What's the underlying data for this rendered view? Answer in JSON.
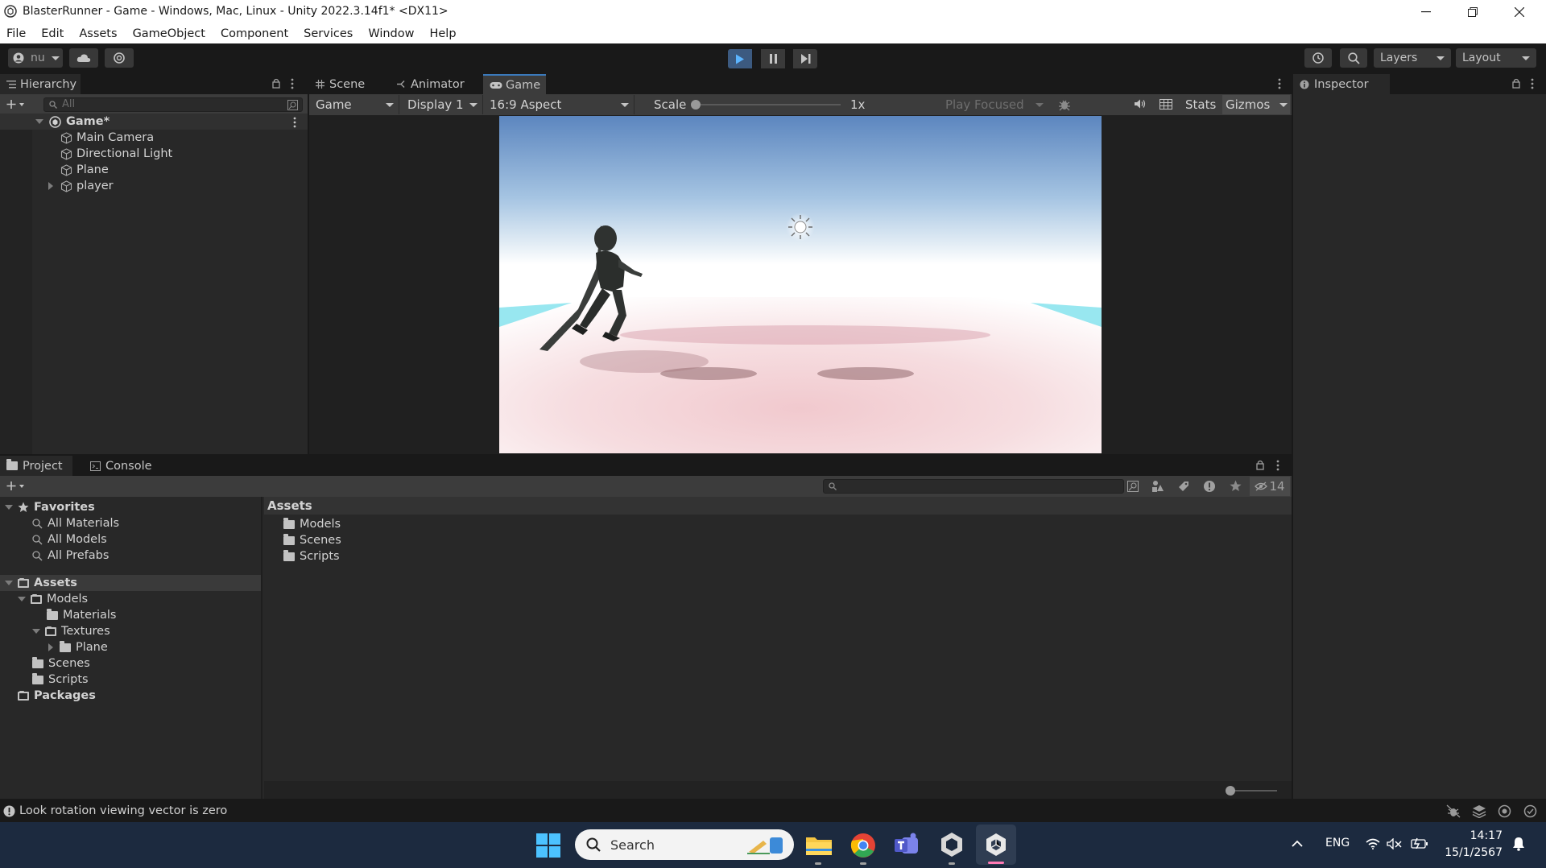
{
  "window": {
    "title": "BlasterRunner - Game - Windows, Mac, Linux - Unity 2022.3.14f1* <DX11>"
  },
  "menu": [
    "File",
    "Edit",
    "Assets",
    "GameObject",
    "Component",
    "Services",
    "Window",
    "Help"
  ],
  "toolbar": {
    "account_label": "nu",
    "layers_label": "Layers",
    "layout_label": "Layout"
  },
  "hierarchy": {
    "tab_label": "Hierarchy",
    "search_placeholder": "All",
    "scene_name": "Game*",
    "items": [
      "Main Camera",
      "Directional Light",
      "Plane",
      "player"
    ]
  },
  "scene_tabs": {
    "scene": "Scene",
    "animator": "Animator",
    "game": "Game"
  },
  "game_toolbar": {
    "view_select": "Game",
    "display_select": "Display 1",
    "aspect_select": "16:9 Aspect",
    "scale_label": "Scale",
    "scale_value": "1x",
    "play_mode": "Play Focused",
    "stats_label": "Stats",
    "gizmos_label": "Gizmos"
  },
  "inspector": {
    "tab_label": "Inspector"
  },
  "bottom_tabs": {
    "project": "Project",
    "console": "Console",
    "hidden_count": "14"
  },
  "project_tree": {
    "favorites_label": "Favorites",
    "favorites": [
      "All Materials",
      "All Models",
      "All Prefabs"
    ],
    "assets_label": "Assets",
    "models": "Models",
    "materials": "Materials",
    "textures": "Textures",
    "plane": "Plane",
    "scenes": "Scenes",
    "scripts": "Scripts",
    "packages_label": "Packages"
  },
  "asset_view": {
    "breadcrumb": "Assets",
    "items": [
      "Models",
      "Scenes",
      "Scripts"
    ]
  },
  "statusbar": {
    "message": "Look rotation viewing vector is zero"
  },
  "taskbar": {
    "search_placeholder": "Search",
    "language": "ENG",
    "time": "14:17",
    "date": "15/1/2567"
  },
  "colors": {
    "accent": "#3a79bb",
    "panel": "#282828",
    "sky_top": "#5c86bf",
    "ground": "#f4d6db"
  }
}
